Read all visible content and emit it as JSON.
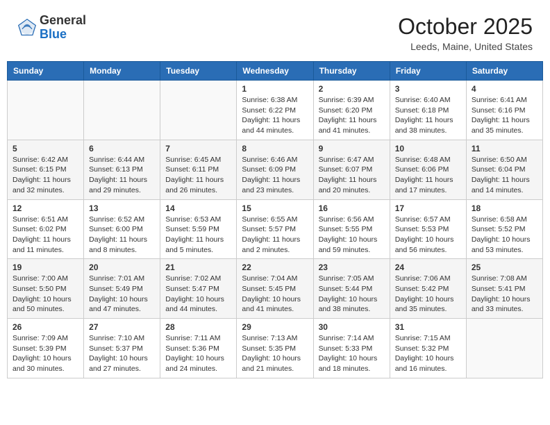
{
  "header": {
    "logo_general": "General",
    "logo_blue": "Blue",
    "month_title": "October 2025",
    "location": "Leeds, Maine, United States"
  },
  "calendar": {
    "days_of_week": [
      "Sunday",
      "Monday",
      "Tuesday",
      "Wednesday",
      "Thursday",
      "Friday",
      "Saturday"
    ],
    "weeks": [
      [
        {
          "day": "",
          "info": ""
        },
        {
          "day": "",
          "info": ""
        },
        {
          "day": "",
          "info": ""
        },
        {
          "day": "1",
          "info": "Sunrise: 6:38 AM\nSunset: 6:22 PM\nDaylight: 11 hours\nand 44 minutes."
        },
        {
          "day": "2",
          "info": "Sunrise: 6:39 AM\nSunset: 6:20 PM\nDaylight: 11 hours\nand 41 minutes."
        },
        {
          "day": "3",
          "info": "Sunrise: 6:40 AM\nSunset: 6:18 PM\nDaylight: 11 hours\nand 38 minutes."
        },
        {
          "day": "4",
          "info": "Sunrise: 6:41 AM\nSunset: 6:16 PM\nDaylight: 11 hours\nand 35 minutes."
        }
      ],
      [
        {
          "day": "5",
          "info": "Sunrise: 6:42 AM\nSunset: 6:15 PM\nDaylight: 11 hours\nand 32 minutes."
        },
        {
          "day": "6",
          "info": "Sunrise: 6:44 AM\nSunset: 6:13 PM\nDaylight: 11 hours\nand 29 minutes."
        },
        {
          "day": "7",
          "info": "Sunrise: 6:45 AM\nSunset: 6:11 PM\nDaylight: 11 hours\nand 26 minutes."
        },
        {
          "day": "8",
          "info": "Sunrise: 6:46 AM\nSunset: 6:09 PM\nDaylight: 11 hours\nand 23 minutes."
        },
        {
          "day": "9",
          "info": "Sunrise: 6:47 AM\nSunset: 6:07 PM\nDaylight: 11 hours\nand 20 minutes."
        },
        {
          "day": "10",
          "info": "Sunrise: 6:48 AM\nSunset: 6:06 PM\nDaylight: 11 hours\nand 17 minutes."
        },
        {
          "day": "11",
          "info": "Sunrise: 6:50 AM\nSunset: 6:04 PM\nDaylight: 11 hours\nand 14 minutes."
        }
      ],
      [
        {
          "day": "12",
          "info": "Sunrise: 6:51 AM\nSunset: 6:02 PM\nDaylight: 11 hours\nand 11 minutes."
        },
        {
          "day": "13",
          "info": "Sunrise: 6:52 AM\nSunset: 6:00 PM\nDaylight: 11 hours\nand 8 minutes."
        },
        {
          "day": "14",
          "info": "Sunrise: 6:53 AM\nSunset: 5:59 PM\nDaylight: 11 hours\nand 5 minutes."
        },
        {
          "day": "15",
          "info": "Sunrise: 6:55 AM\nSunset: 5:57 PM\nDaylight: 11 hours\nand 2 minutes."
        },
        {
          "day": "16",
          "info": "Sunrise: 6:56 AM\nSunset: 5:55 PM\nDaylight: 10 hours\nand 59 minutes."
        },
        {
          "day": "17",
          "info": "Sunrise: 6:57 AM\nSunset: 5:53 PM\nDaylight: 10 hours\nand 56 minutes."
        },
        {
          "day": "18",
          "info": "Sunrise: 6:58 AM\nSunset: 5:52 PM\nDaylight: 10 hours\nand 53 minutes."
        }
      ],
      [
        {
          "day": "19",
          "info": "Sunrise: 7:00 AM\nSunset: 5:50 PM\nDaylight: 10 hours\nand 50 minutes."
        },
        {
          "day": "20",
          "info": "Sunrise: 7:01 AM\nSunset: 5:49 PM\nDaylight: 10 hours\nand 47 minutes."
        },
        {
          "day": "21",
          "info": "Sunrise: 7:02 AM\nSunset: 5:47 PM\nDaylight: 10 hours\nand 44 minutes."
        },
        {
          "day": "22",
          "info": "Sunrise: 7:04 AM\nSunset: 5:45 PM\nDaylight: 10 hours\nand 41 minutes."
        },
        {
          "day": "23",
          "info": "Sunrise: 7:05 AM\nSunset: 5:44 PM\nDaylight: 10 hours\nand 38 minutes."
        },
        {
          "day": "24",
          "info": "Sunrise: 7:06 AM\nSunset: 5:42 PM\nDaylight: 10 hours\nand 35 minutes."
        },
        {
          "day": "25",
          "info": "Sunrise: 7:08 AM\nSunset: 5:41 PM\nDaylight: 10 hours\nand 33 minutes."
        }
      ],
      [
        {
          "day": "26",
          "info": "Sunrise: 7:09 AM\nSunset: 5:39 PM\nDaylight: 10 hours\nand 30 minutes."
        },
        {
          "day": "27",
          "info": "Sunrise: 7:10 AM\nSunset: 5:37 PM\nDaylight: 10 hours\nand 27 minutes."
        },
        {
          "day": "28",
          "info": "Sunrise: 7:11 AM\nSunset: 5:36 PM\nDaylight: 10 hours\nand 24 minutes."
        },
        {
          "day": "29",
          "info": "Sunrise: 7:13 AM\nSunset: 5:35 PM\nDaylight: 10 hours\nand 21 minutes."
        },
        {
          "day": "30",
          "info": "Sunrise: 7:14 AM\nSunset: 5:33 PM\nDaylight: 10 hours\nand 18 minutes."
        },
        {
          "day": "31",
          "info": "Sunrise: 7:15 AM\nSunset: 5:32 PM\nDaylight: 10 hours\nand 16 minutes."
        },
        {
          "day": "",
          "info": ""
        }
      ]
    ]
  }
}
